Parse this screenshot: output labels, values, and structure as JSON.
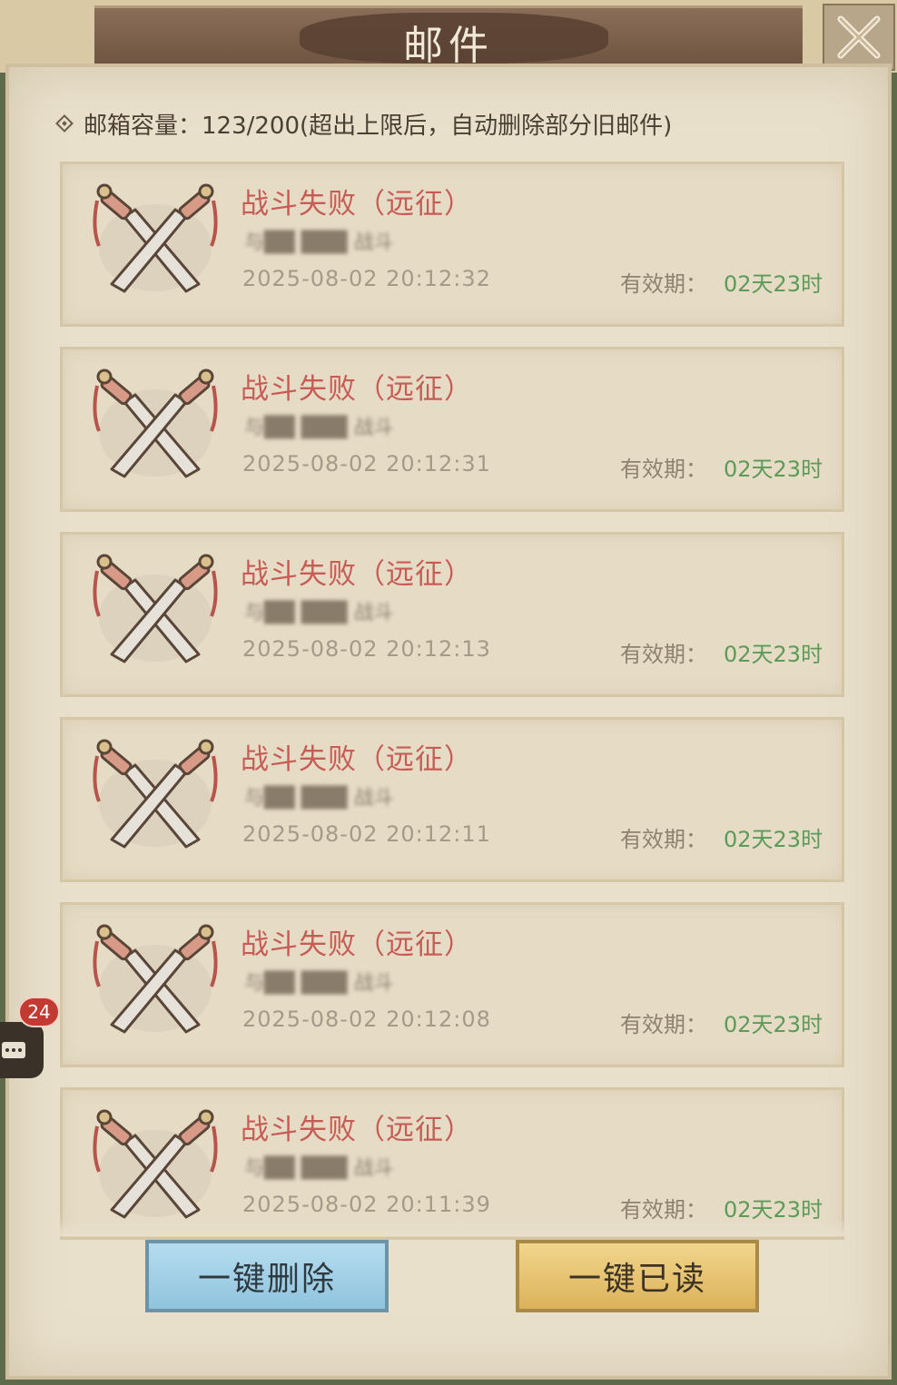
{
  "window": {
    "title": "邮件",
    "close_icon": "close-x-icon"
  },
  "mailbox": {
    "capacity_label": "邮箱容量：123/200(超出上限后，自动删除部分旧邮件)"
  },
  "mails": [
    {
      "title": "战斗失败（远征）",
      "subtitle": "与██ ███ 战斗",
      "time": "2025-08-02  20:12:32",
      "expire_label": "有效期：",
      "expire_value": "02天23时",
      "icon": "crossed-swords-icon"
    },
    {
      "title": "战斗失败（远征）",
      "subtitle": "与██ ███ 战斗",
      "time": "2025-08-02  20:12:31",
      "expire_label": "有效期：",
      "expire_value": "02天23时",
      "icon": "crossed-swords-icon"
    },
    {
      "title": "战斗失败（远征）",
      "subtitle": "与██ ███ 战斗",
      "time": "2025-08-02  20:12:13",
      "expire_label": "有效期：",
      "expire_value": "02天23时",
      "icon": "crossed-swords-icon"
    },
    {
      "title": "战斗失败（远征）",
      "subtitle": "与██ ███ 战斗",
      "time": "2025-08-02  20:12:11",
      "expire_label": "有效期：",
      "expire_value": "02天23时",
      "icon": "crossed-swords-icon"
    },
    {
      "title": "战斗失败（远征）",
      "subtitle": "与██ ███ 战斗",
      "time": "2025-08-02  20:12:08",
      "expire_label": "有效期：",
      "expire_value": "02天23时",
      "icon": "crossed-swords-icon"
    },
    {
      "title": "战斗失败（远征）",
      "subtitle": "与██ ███ 战斗",
      "time": "2025-08-02  20:11:39",
      "expire_label": "有效期：",
      "expire_value": "02天23时",
      "icon": "crossed-swords-icon"
    }
  ],
  "actions": {
    "delete_all": "一键删除",
    "read_all": "一键已读"
  },
  "side": {
    "chat_badge": "24",
    "chat_icon": "chat-bubble-icon"
  },
  "colors": {
    "title_red": "#c65c55",
    "expire_green": "#5c9a5a",
    "delete_blue": "#9ccbe3",
    "read_gold": "#e3bf6d"
  }
}
